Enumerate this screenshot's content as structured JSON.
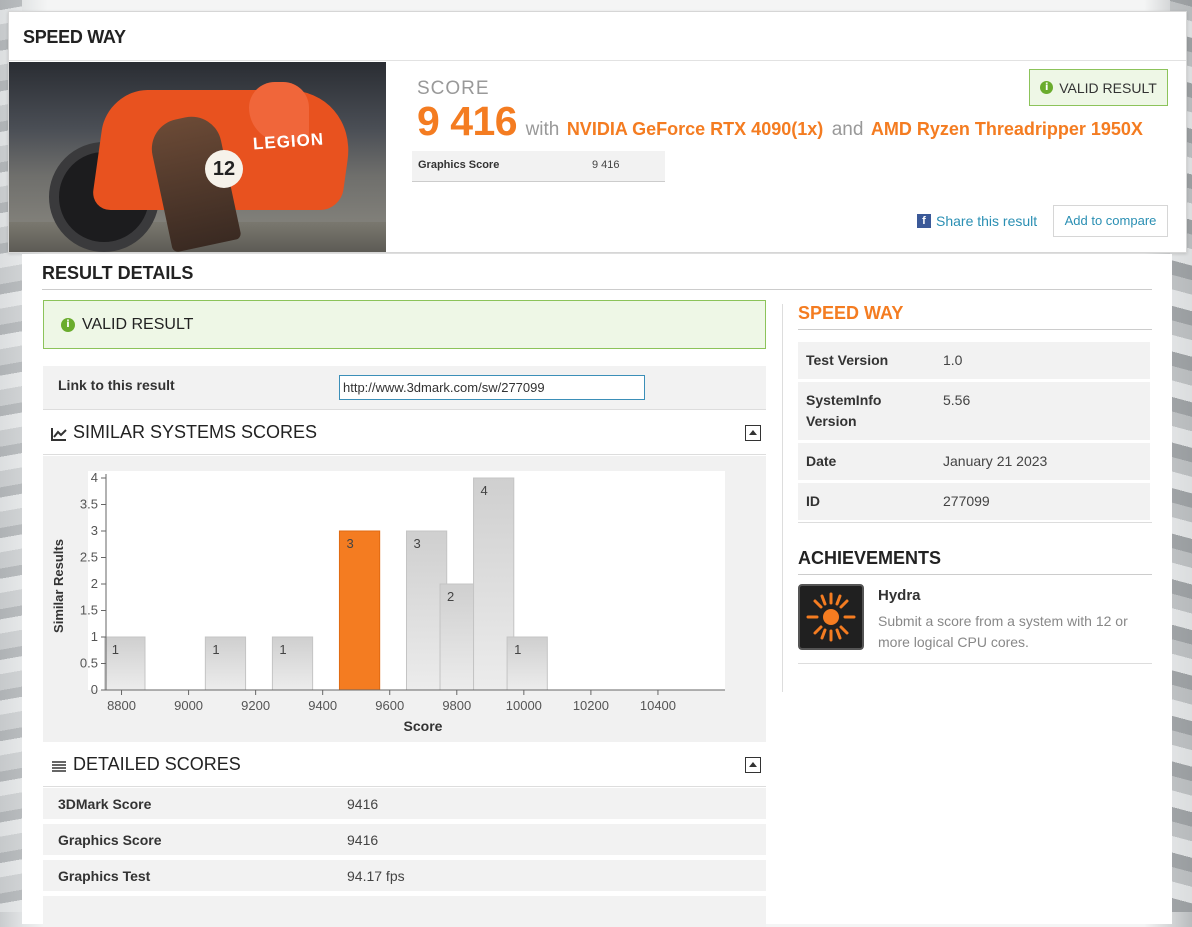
{
  "header": {
    "title": "SPEED WAY",
    "hero_brand": "LEGION",
    "hero_number": "12",
    "score_label": "SCORE",
    "score_value": "9 416",
    "with_text": "with",
    "gpu": "NVIDIA GeForce RTX 4090(1x)",
    "and_text": "and",
    "cpu": "AMD Ryzen Threadripper 1950X",
    "graphics_score_label": "Graphics Score",
    "graphics_score_value": "9 416",
    "valid_label": "VALID RESULT",
    "share_label": "Share this result",
    "compare_label": "Add to compare"
  },
  "result_details": {
    "title": "RESULT DETAILS",
    "valid_label": "VALID RESULT",
    "link_label": "Link to this result",
    "link_value": "http://www.3dmark.com/sw/277099"
  },
  "similar": {
    "title": "SIMILAR SYSTEMS SCORES"
  },
  "chart_data": {
    "type": "bar",
    "xlabel": "Score",
    "ylabel": "Similar Results",
    "xlim": [
      8700,
      10600
    ],
    "ylim": [
      0,
      4
    ],
    "x_ticks": [
      8800,
      9000,
      9200,
      9400,
      9600,
      9800,
      10000,
      10200,
      10400
    ],
    "y_ticks": [
      0,
      0.5,
      1,
      1.5,
      2,
      2.5,
      3,
      3.5,
      4
    ],
    "bars": [
      {
        "bin_start": 8750,
        "bin_end": 8870,
        "value": 1
      },
      {
        "bin_start": 9050,
        "bin_end": 9170,
        "value": 1
      },
      {
        "bin_start": 9250,
        "bin_end": 9370,
        "value": 1
      },
      {
        "bin_start": 9450,
        "bin_end": 9570,
        "value": 3,
        "highlight": true
      },
      {
        "bin_start": 9650,
        "bin_end": 9770,
        "value": 3
      },
      {
        "bin_start": 9750,
        "bin_end": 9850,
        "value": 2
      },
      {
        "bin_start": 9850,
        "bin_end": 9970,
        "value": 4
      },
      {
        "bin_start": 9950,
        "bin_end": 10070,
        "value": 1
      }
    ],
    "colors": {
      "highlight": "#f47c21",
      "bar": "#d6d6d6"
    }
  },
  "detailed": {
    "title": "DETAILED SCORES",
    "rows": [
      {
        "label": "3DMark Score",
        "value": "9416"
      },
      {
        "label": "Graphics Score",
        "value": "9416"
      },
      {
        "label": "Graphics Test",
        "value": "94.17 fps"
      }
    ]
  },
  "sidebar": {
    "title": "SPEED WAY",
    "rows": [
      {
        "label": "Test Version",
        "value": "1.0"
      },
      {
        "label": "SystemInfo Version",
        "value": "5.56"
      },
      {
        "label": "Date",
        "value": "January 21 2023"
      },
      {
        "label": "ID",
        "value": "277099"
      }
    ],
    "achievements_title": "ACHIEVEMENTS",
    "achievement": {
      "name": "Hydra",
      "description": "Submit a score from a system with 12 or more logical CPU cores.",
      "icon": "hydra-sun-icon"
    }
  },
  "colors": {
    "accent": "#f47c21",
    "valid_bg": "#eef7e6",
    "valid_border": "#8cc35a",
    "link": "#2a8fb3"
  }
}
